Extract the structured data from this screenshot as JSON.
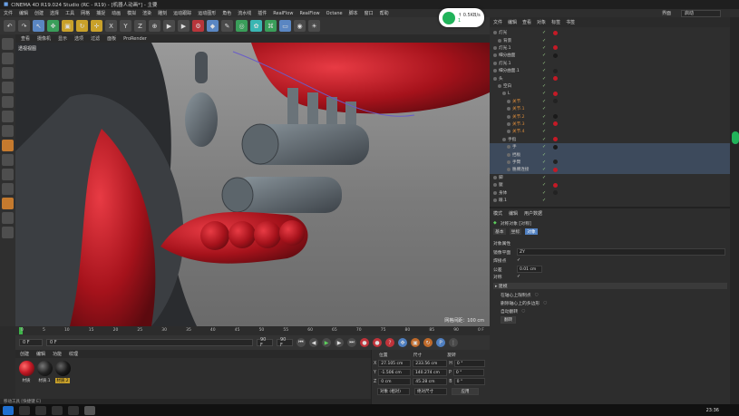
{
  "window": {
    "title": "CINEMA 4D R19.024 Studio (RC - R19) - [机器人动画*] - 主要"
  },
  "menubar": {
    "items": [
      "文件",
      "编辑",
      "创建",
      "选择",
      "工具",
      "网格",
      "捕捉",
      "动画",
      "模拟",
      "渲染",
      "雕刻",
      "运动跟踪",
      "运动图形",
      "角色",
      "流水线",
      "插件",
      "RealFlow",
      "RealFlow",
      "Octane",
      "脚本",
      "窗口",
      "帮助"
    ],
    "layout_label": "界面",
    "layout_value": "启动"
  },
  "viewport": {
    "tabs": [
      "查看",
      "摄像机",
      "显示",
      "选项",
      "过滤",
      "面板",
      "ProRender"
    ],
    "label": "透视视图",
    "grid_scale": "网格间距：100 cm"
  },
  "timeline": {
    "ticks": [
      "0",
      "5",
      "10",
      "15",
      "20",
      "25",
      "30",
      "35",
      "40",
      "45",
      "50",
      "55",
      "60",
      "65",
      "70",
      "75",
      "80",
      "85",
      "90"
    ],
    "frame_end": "0 F"
  },
  "timecontrol": {
    "start": "0 F",
    "current": "0 F",
    "end": "90 F",
    "max": "90 F"
  },
  "materials": {
    "tabs": [
      "创建",
      "编辑",
      "功能",
      "纹理"
    ],
    "items": [
      {
        "label": "材质",
        "color": "#c41a26"
      },
      {
        "label": "材质.1",
        "color": "#222222"
      },
      {
        "label": "材质.2",
        "color": "#1a1a1a"
      }
    ]
  },
  "coords": {
    "headers": [
      "位置",
      "尺寸",
      "旋转"
    ],
    "rows": [
      {
        "axis": "X",
        "pos": "27.105 cm",
        "size": "233.56 cm",
        "rot_axis": "H",
        "rot": "0 °"
      },
      {
        "axis": "Y",
        "pos": "-1.506 cm",
        "size": "140.274 cm",
        "rot_axis": "P",
        "rot": "0 °"
      },
      {
        "axis": "Z",
        "pos": "0 cm",
        "size": "45.28 cm",
        "rot_axis": "B",
        "rot": "0 °"
      }
    ],
    "mode_select": "对象 (相对)",
    "size_select": "绝对尺寸",
    "apply": "应用"
  },
  "objects": {
    "header": [
      "文件",
      "编辑",
      "查看",
      "对象",
      "标签",
      "书签"
    ],
    "rows": [
      {
        "name": "灯光",
        "indent": 0
      },
      {
        "name": "背景",
        "indent": 1
      },
      {
        "name": "灯光.1",
        "indent": 0
      },
      {
        "name": "细分曲面",
        "indent": 0
      },
      {
        "name": "灯光.1",
        "indent": 0
      },
      {
        "name": "细分曲面.1",
        "indent": 0
      },
      {
        "name": "头",
        "indent": 0
      },
      {
        "name": "空白",
        "indent": 1
      },
      {
        "name": "L",
        "indent": 2
      },
      {
        "name": "关节",
        "indent": 3
      },
      {
        "name": "关节.1",
        "indent": 3
      },
      {
        "name": "关节.2",
        "indent": 3
      },
      {
        "name": "关节.3",
        "indent": 3
      },
      {
        "name": "关节.4",
        "indent": 3
      },
      {
        "name": "手指",
        "indent": 2
      },
      {
        "name": "手",
        "indent": 3
      },
      {
        "name": "挡板",
        "indent": 3
      },
      {
        "name": "手臂",
        "indent": 3
      },
      {
        "name": "胳膊连接",
        "indent": 3
      },
      {
        "name": "脚",
        "indent": 0
      },
      {
        "name": "腿",
        "indent": 0
      },
      {
        "name": "身体",
        "indent": 0
      },
      {
        "name": "眼.1",
        "indent": 0
      }
    ]
  },
  "attributes": {
    "header": [
      "模式",
      "编辑",
      "用户数据"
    ],
    "object_title": "对称对象 [对称]",
    "tabs": [
      "基本",
      "坐标",
      "对象"
    ],
    "section": "对象属性",
    "fields": [
      {
        "label": "镜像平面",
        "value": "ZY"
      },
      {
        "label": "焊接点",
        "value": "✓"
      },
      {
        "label": "公差",
        "value": "0.01 cm"
      },
      {
        "label": "对称",
        "value": "✓"
      }
    ],
    "subsection": "▸ 建模",
    "extra": [
      "在轴心上限制点",
      "删除轴心上的多边形",
      "自动翻转"
    ],
    "button": "翻转"
  },
  "wifi": {
    "speed": "↑ 0.5KB/s",
    "count": "1"
  },
  "status": {
    "text": "移动工具 [快捷键 E]"
  },
  "taskbar": {
    "time": "23:36"
  }
}
